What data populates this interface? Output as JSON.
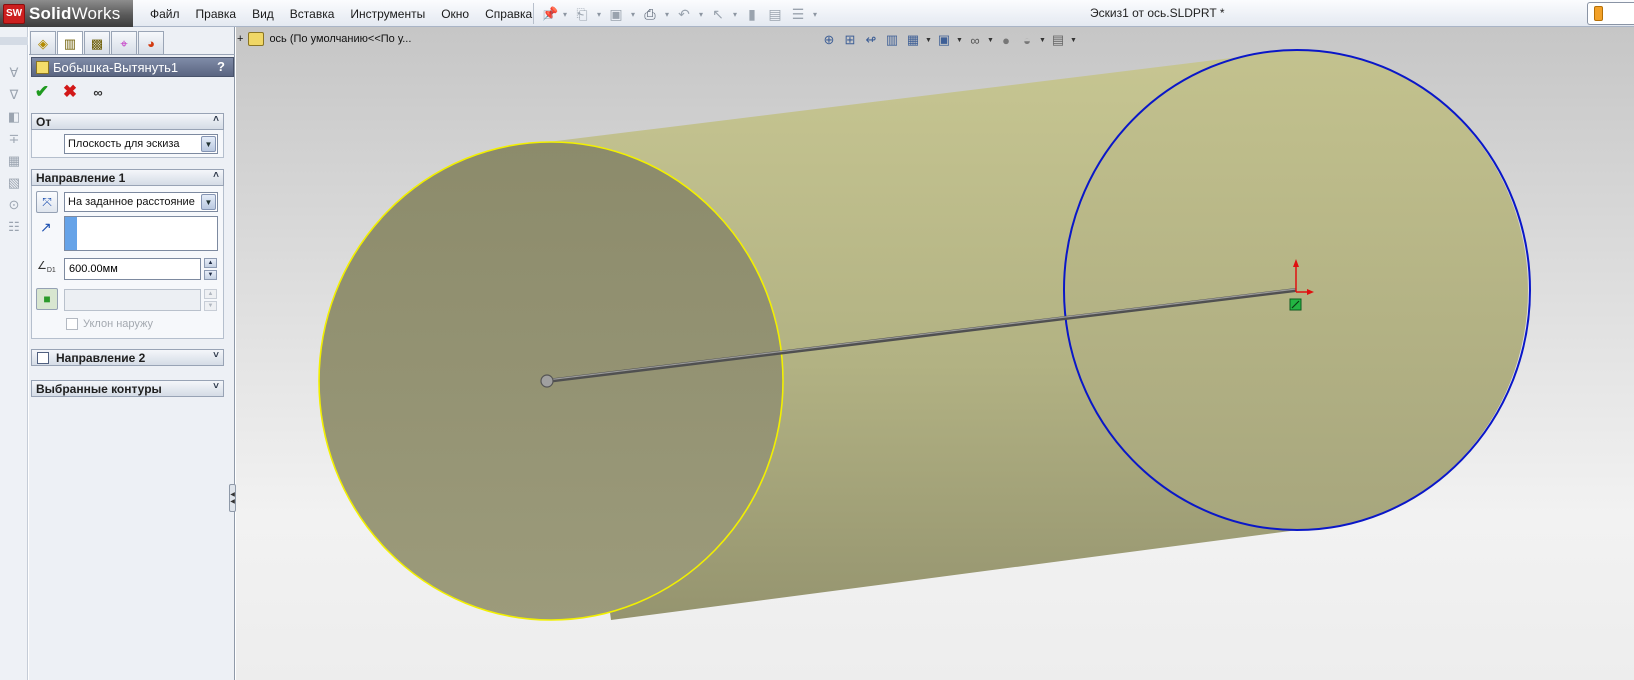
{
  "app": {
    "name_bold": "Solid",
    "name_light": "Works",
    "logo_text": "SW",
    "document_title": "Эскиз1 от ось.SLDPRT *"
  },
  "menu": {
    "items": [
      "Файл",
      "Правка",
      "Вид",
      "Вставка",
      "Инструменты",
      "Окно",
      "Справка"
    ]
  },
  "property_manager": {
    "title": "Бобышка-Вытянуть1",
    "help": "?",
    "from_group": {
      "label": "От",
      "start_condition": "Плоскость для эскиза"
    },
    "direction1_group": {
      "label": "Направление 1",
      "end_condition": "На заданное расстояние",
      "depth_value": "600.00мм",
      "depth_icon_label": "D1",
      "draft_outward_label": "Уклон наружу"
    },
    "direction2_group": {
      "label": "Направление 2"
    },
    "contours_group": {
      "label": "Выбранные контуры"
    }
  },
  "feature_tree": {
    "breadcrumb": "ось  (По умолчанию<<По у..."
  },
  "colors": {
    "title_bar": "#5a6581",
    "cylinder_face": "#b9b985",
    "cylinder_end": "#8f8f6c",
    "selected_edge": "#f2f000",
    "sketch_circle": "#0a17c8",
    "axis_line": "#606060"
  }
}
